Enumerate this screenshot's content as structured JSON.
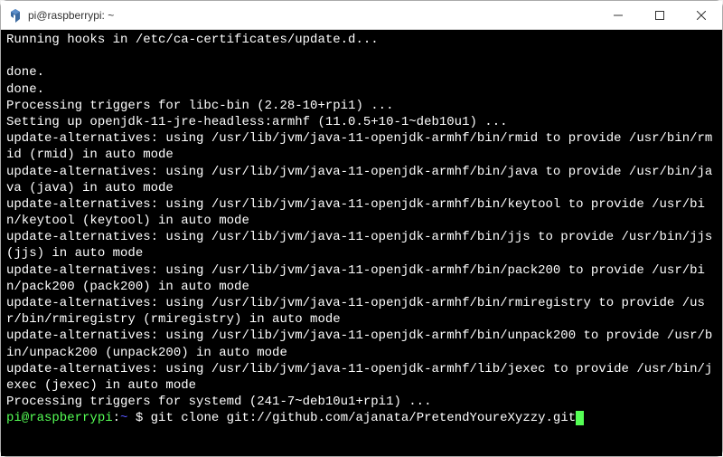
{
  "window": {
    "title": "pi@raspberrypi: ~"
  },
  "terminal": {
    "lines": [
      "Running hooks in /etc/ca-certificates/update.d...",
      "",
      "done.",
      "done.",
      "Processing triggers for libc-bin (2.28-10+rpi1) ...",
      "Setting up openjdk-11-jre-headless:armhf (11.0.5+10-1~deb10u1) ...",
      "update-alternatives: using /usr/lib/jvm/java-11-openjdk-armhf/bin/rmid to provide /usr/bin/rmid (rmid) in auto mode",
      "update-alternatives: using /usr/lib/jvm/java-11-openjdk-armhf/bin/java to provide /usr/bin/java (java) in auto mode",
      "update-alternatives: using /usr/lib/jvm/java-11-openjdk-armhf/bin/keytool to provide /usr/bin/keytool (keytool) in auto mode",
      "update-alternatives: using /usr/lib/jvm/java-11-openjdk-armhf/bin/jjs to provide /usr/bin/jjs (jjs) in auto mode",
      "update-alternatives: using /usr/lib/jvm/java-11-openjdk-armhf/bin/pack200 to provide /usr/bin/pack200 (pack200) in auto mode",
      "update-alternatives: using /usr/lib/jvm/java-11-openjdk-armhf/bin/rmiregistry to provide /usr/bin/rmiregistry (rmiregistry) in auto mode",
      "update-alternatives: using /usr/lib/jvm/java-11-openjdk-armhf/bin/unpack200 to provide /usr/bin/unpack200 (unpack200) in auto mode",
      "update-alternatives: using /usr/lib/jvm/java-11-openjdk-armhf/lib/jexec to provide /usr/bin/jexec (jexec) in auto mode",
      "Processing triggers for systemd (241-7~deb10u1+rpi1) ..."
    ],
    "prompt": {
      "user_host": "pi@raspberrypi",
      "separator": ":",
      "path": "~",
      "symbol": " $ ",
      "command": "git clone git://github.com/ajanata/PretendYoureXyzzy.git"
    }
  }
}
